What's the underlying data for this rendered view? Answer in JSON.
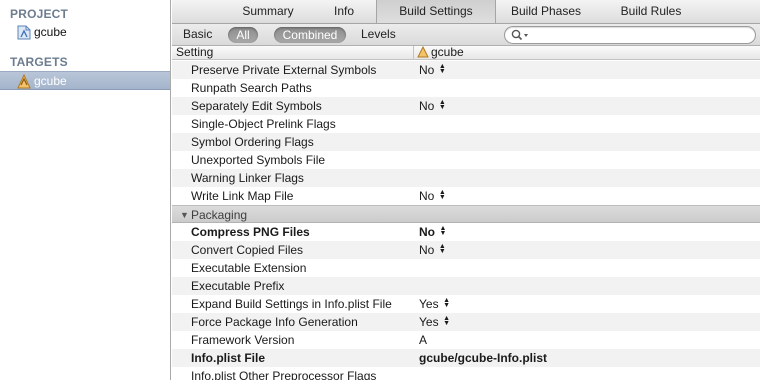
{
  "sidebar": {
    "project_header": "PROJECT",
    "project_item": "gcube",
    "targets_header": "TARGETS",
    "target_item": "gcube"
  },
  "tabs": [
    {
      "label": "Summary",
      "active": false
    },
    {
      "label": "Info",
      "active": false
    },
    {
      "label": "Build Settings",
      "active": true
    },
    {
      "label": "Build Phases",
      "active": false
    },
    {
      "label": "Build Rules",
      "active": false
    }
  ],
  "filter": {
    "basic": "Basic",
    "all": "All",
    "combined": "Combined",
    "levels": "Levels",
    "search_placeholder": ""
  },
  "columns": {
    "setting": "Setting",
    "target": "gcube"
  },
  "rows_linking": [
    {
      "name": "Preserve Private External Symbols",
      "value": "No",
      "popup": true
    },
    {
      "name": "Runpath Search Paths",
      "value": "",
      "popup": false
    },
    {
      "name": "Separately Edit Symbols",
      "value": "No",
      "popup": true
    },
    {
      "name": "Single-Object Prelink Flags",
      "value": "",
      "popup": false
    },
    {
      "name": "Symbol Ordering Flags",
      "value": "",
      "popup": false
    },
    {
      "name": "Unexported Symbols File",
      "value": "",
      "popup": false
    },
    {
      "name": "Warning Linker Flags",
      "value": "",
      "popup": false
    },
    {
      "name": "Write Link Map File",
      "value": "No",
      "popup": true
    }
  ],
  "section_packaging": "Packaging",
  "rows_packaging": [
    {
      "name": "Compress PNG Files",
      "value": "No",
      "popup": true,
      "bold": true
    },
    {
      "name": "Convert Copied Files",
      "value": "No",
      "popup": true,
      "bold": false
    },
    {
      "name": "Executable Extension",
      "value": "",
      "popup": false,
      "bold": false
    },
    {
      "name": "Executable Prefix",
      "value": "",
      "popup": false,
      "bold": false
    },
    {
      "name": "Expand Build Settings in Info.plist File",
      "value": "Yes",
      "popup": true,
      "bold": false
    },
    {
      "name": "Force Package Info Generation",
      "value": "Yes",
      "popup": true,
      "bold": false
    },
    {
      "name": "Framework Version",
      "value": "A",
      "popup": false,
      "bold": false
    },
    {
      "name": "Info.plist File",
      "value": "gcube/gcube-Info.plist",
      "popup": false,
      "bold": true
    },
    {
      "name": "Info.plist Other Preprocessor Flags",
      "value": "",
      "popup": false,
      "bold": false
    }
  ],
  "colors": {
    "selection": "#a4b4cb",
    "sidebar_header": "#6d7c8f",
    "pill": "#999999"
  },
  "icons": {
    "project": "xcode-project-icon",
    "target": "app-target-icon",
    "search": "search-icon",
    "disclosure": "disclosure-triangle-icon",
    "popup": "popup-arrows-icon"
  }
}
